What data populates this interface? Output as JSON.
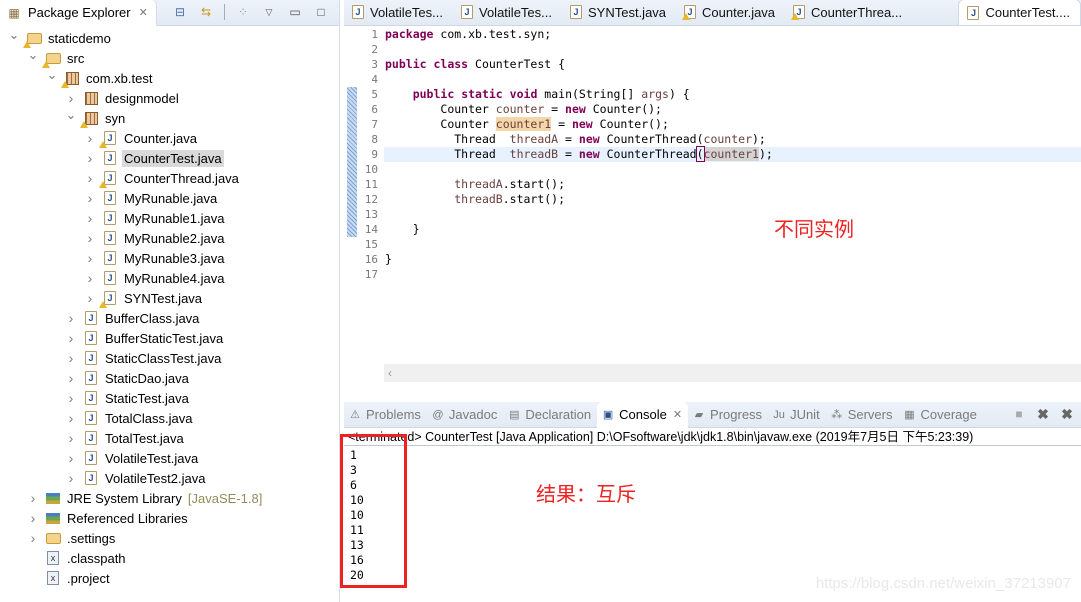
{
  "explorer": {
    "title": "Package Explorer",
    "toolbar_icons": [
      "collapse-all-icon",
      "link-with-editor-icon",
      "filter-icon",
      "view-menu-icon",
      "minimize-icon",
      "maximize-icon"
    ],
    "tree": [
      {
        "label": "staticdemo",
        "depth": 0,
        "twisty": "expanded",
        "icon": "project",
        "warn": true
      },
      {
        "label": "src",
        "depth": 1,
        "twisty": "expanded",
        "icon": "folder",
        "warn": true
      },
      {
        "label": "com.xb.test",
        "depth": 2,
        "twisty": "expanded",
        "icon": "package",
        "warn": true
      },
      {
        "label": "designmodel",
        "depth": 3,
        "twisty": "collapsed",
        "icon": "package",
        "warn": false
      },
      {
        "label": "syn",
        "depth": 3,
        "twisty": "expanded",
        "icon": "package",
        "warn": true
      },
      {
        "label": "Counter.java",
        "depth": 4,
        "twisty": "collapsed",
        "icon": "java",
        "warn": true
      },
      {
        "label": "CounterTest.java",
        "depth": 4,
        "twisty": "collapsed",
        "icon": "java",
        "warn": false,
        "selected": true
      },
      {
        "label": "CounterThread.java",
        "depth": 4,
        "twisty": "collapsed",
        "icon": "java",
        "warn": true
      },
      {
        "label": "MyRunable.java",
        "depth": 4,
        "twisty": "collapsed",
        "icon": "java",
        "warn": false
      },
      {
        "label": "MyRunable1.java",
        "depth": 4,
        "twisty": "collapsed",
        "icon": "java",
        "warn": false
      },
      {
        "label": "MyRunable2.java",
        "depth": 4,
        "twisty": "collapsed",
        "icon": "java",
        "warn": false
      },
      {
        "label": "MyRunable3.java",
        "depth": 4,
        "twisty": "collapsed",
        "icon": "java",
        "warn": false
      },
      {
        "label": "MyRunable4.java",
        "depth": 4,
        "twisty": "collapsed",
        "icon": "java",
        "warn": false
      },
      {
        "label": "SYNTest.java",
        "depth": 4,
        "twisty": "collapsed",
        "icon": "java",
        "warn": true
      },
      {
        "label": "BufferClass.java",
        "depth": 3,
        "twisty": "collapsed",
        "icon": "java",
        "warn": false
      },
      {
        "label": "BufferStaticTest.java",
        "depth": 3,
        "twisty": "collapsed",
        "icon": "java",
        "warn": false
      },
      {
        "label": "StaticClassTest.java",
        "depth": 3,
        "twisty": "collapsed",
        "icon": "java",
        "warn": false
      },
      {
        "label": "StaticDao.java",
        "depth": 3,
        "twisty": "collapsed",
        "icon": "java",
        "warn": false
      },
      {
        "label": "StaticTest.java",
        "depth": 3,
        "twisty": "collapsed",
        "icon": "java",
        "warn": false
      },
      {
        "label": "TotalClass.java",
        "depth": 3,
        "twisty": "collapsed",
        "icon": "java",
        "warn": false
      },
      {
        "label": "TotalTest.java",
        "depth": 3,
        "twisty": "collapsed",
        "icon": "java",
        "warn": false
      },
      {
        "label": "VolatileTest.java",
        "depth": 3,
        "twisty": "collapsed",
        "icon": "java",
        "warn": false
      },
      {
        "label": "VolatileTest2.java",
        "depth": 3,
        "twisty": "collapsed",
        "icon": "java",
        "warn": false
      },
      {
        "label": "JRE System Library",
        "decoration": "[JavaSE-1.8]",
        "depth": 1,
        "twisty": "collapsed",
        "icon": "library",
        "warn": false
      },
      {
        "label": "Referenced Libraries",
        "depth": 1,
        "twisty": "collapsed",
        "icon": "library",
        "warn": false
      },
      {
        "label": ".settings",
        "depth": 1,
        "twisty": "collapsed",
        "icon": "folder",
        "warn": false
      },
      {
        "label": ".classpath",
        "depth": 1,
        "twisty": "none",
        "icon": "xml",
        "warn": false
      },
      {
        "label": ".project",
        "depth": 1,
        "twisty": "none",
        "icon": "xml",
        "warn": false
      }
    ]
  },
  "editor": {
    "tabs": [
      {
        "label": "VolatileTes...",
        "warn": false,
        "active": false
      },
      {
        "label": "VolatileTes...",
        "warn": false,
        "active": false
      },
      {
        "label": "SYNTest.java",
        "warn": false,
        "active": false
      },
      {
        "label": "Counter.java",
        "warn": true,
        "active": false
      },
      {
        "label": "CounterThrea...",
        "warn": true,
        "active": false
      },
      {
        "label": "CounterTest....",
        "warn": false,
        "active": true
      }
    ],
    "line_numbers": [
      "1",
      "2",
      "3",
      "4",
      "5",
      "6",
      "7",
      "8",
      "9",
      "10",
      "11",
      "12",
      "13",
      "14",
      "15",
      "16",
      "17"
    ],
    "code": {
      "l1_kw": "package",
      "l1_rest": " com.xb.test.syn;",
      "l3_kw1": "public",
      "l3_kw2": "class",
      "l3_rest": " CounterTest {",
      "l5_kw1": "public",
      "l5_kw2": "static",
      "l5_kw3": "void",
      "l5_rest1": " main(String[] ",
      "l5_var": "args",
      "l5_rest2": ") {",
      "l6_type": "Counter ",
      "l6_var": "counter",
      "l6_eq": " = ",
      "l6_new": "new",
      "l6_rest": " Counter();",
      "l7_type": "Counter ",
      "l7_var": "counter1",
      "l7_eq": " = ",
      "l7_new": "new",
      "l7_rest": " Counter();",
      "l8_type": "Thread  ",
      "l8_var": "threadA",
      "l8_eq": " = ",
      "l8_new": "new",
      "l8_call": " CounterThread(",
      "l8_arg": "counter",
      "l8_end": ");",
      "l9_type": "Thread  ",
      "l9_var": "threadB",
      "l9_eq": " = ",
      "l9_new": "new",
      "l9_call": " CounterThread",
      "l9_paren": "(",
      "l9_arg": "counter1",
      "l9_end": ");",
      "l11_var": "threadA",
      "l11_rest": ".start();",
      "l12_var": "threadB",
      "l12_rest": ".start();",
      "l14": "}",
      "l16": "}"
    },
    "annotation": "不同实例"
  },
  "console": {
    "tabs": [
      {
        "label": "Problems",
        "icon": "problems-icon",
        "glyph": "⚠",
        "active": false
      },
      {
        "label": "Javadoc",
        "icon": "javadoc-icon",
        "glyph": "@",
        "active": false
      },
      {
        "label": "Declaration",
        "icon": "declaration-icon",
        "glyph": "▤",
        "active": false
      },
      {
        "label": "Console",
        "icon": "console-icon",
        "glyph": "▣",
        "active": true
      },
      {
        "label": "Progress",
        "icon": "progress-icon",
        "glyph": "▰",
        "active": false
      },
      {
        "label": "JUnit",
        "icon": "junit-icon",
        "glyph": "Ju",
        "active": false
      },
      {
        "label": "Servers",
        "icon": "servers-icon",
        "glyph": "⁂",
        "active": false
      },
      {
        "label": "Coverage",
        "icon": "coverage-icon",
        "glyph": "▦",
        "active": false
      }
    ],
    "status": "<terminated> CounterTest [Java Application] D:\\OFsoftware\\jdk\\jdk1.8\\bin\\javaw.exe (2019年7月5日 下午5:23:39)",
    "output": [
      "1",
      "3",
      "6",
      "10",
      "10",
      "11",
      "13",
      "16",
      "20"
    ],
    "annotation": "结果：互斥"
  },
  "watermark": "https://blog.csdn.net/weixin_37213907"
}
